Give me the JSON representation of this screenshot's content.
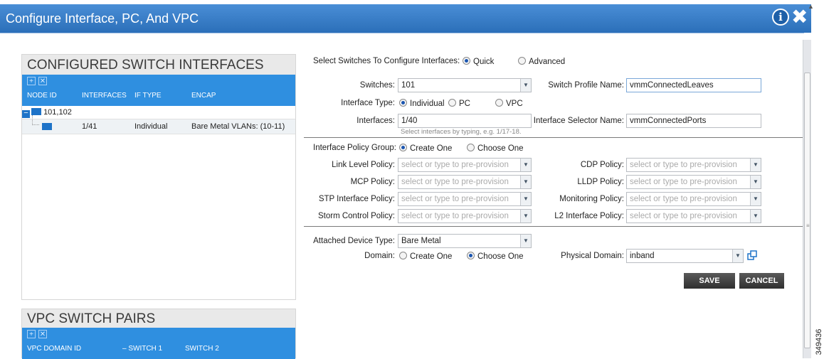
{
  "window": {
    "title": "Configure Interface, PC, And VPC"
  },
  "configured": {
    "title": "CONFIGURED SWITCH INTERFACES",
    "columns": [
      "NODE ID",
      "INTERFACES",
      "IF TYPE",
      "ENCAP"
    ],
    "node": "101,102",
    "rows": [
      {
        "interfaces": "1/41",
        "if_type": "Individual",
        "encap": "Bare Metal VLANs: (10-11)"
      }
    ]
  },
  "vpc": {
    "title": "VPC SWITCH PAIRS",
    "columns": [
      "VPC DOMAIN ID",
      "SWITCH 1",
      "SWITCH 2"
    ]
  },
  "form": {
    "select_switches_label": "Select Switches To Configure Interfaces:",
    "quick": "Quick",
    "advanced": "Advanced",
    "switches_label": "Switches:",
    "switches_value": "101",
    "switch_profile_label": "Switch Profile Name:",
    "switch_profile_value": "vmmConnectedLeaves",
    "interface_type_label": "Interface Type:",
    "individual": "Individual",
    "pc": "PC",
    "vpc": "VPC",
    "interfaces_label": "Interfaces:",
    "interfaces_value": "1/40",
    "interfaces_hint": "Select interfaces by typing, e.g. 1/17-18.",
    "selector_label": "Interface Selector Name:",
    "selector_value": "vmmConnectedPorts",
    "policy_group_label": "Interface Policy Group:",
    "create_one": "Create One",
    "choose_one": "Choose One",
    "placeholder": "select or type to pre-provision",
    "link_level": "Link Level Policy:",
    "cdp": "CDP Policy:",
    "mcp": "MCP Policy:",
    "lldp": "LLDP Policy:",
    "stp": "STP Interface Policy:",
    "monitoring": "Monitoring Policy:",
    "storm": "Storm Control Policy:",
    "l2": "L2 Interface Policy:",
    "attached_label": "Attached Device Type:",
    "attached_value": "Bare Metal",
    "domain_label": "Domain:",
    "physical_domain_label": "Physical Domain:",
    "physical_domain_value": "inband",
    "save": "SAVE",
    "cancel": "CANCEL"
  },
  "watermark": "349436",
  "icons": {
    "info": "info-icon",
    "close": "close-icon",
    "add": "plus-icon",
    "delete": "x-box-icon",
    "open": "popout-icon"
  },
  "colors": {
    "title_bar": "#2f7ac8",
    "grid_header": "#2f8fe0",
    "button": "#3a3a3a"
  }
}
